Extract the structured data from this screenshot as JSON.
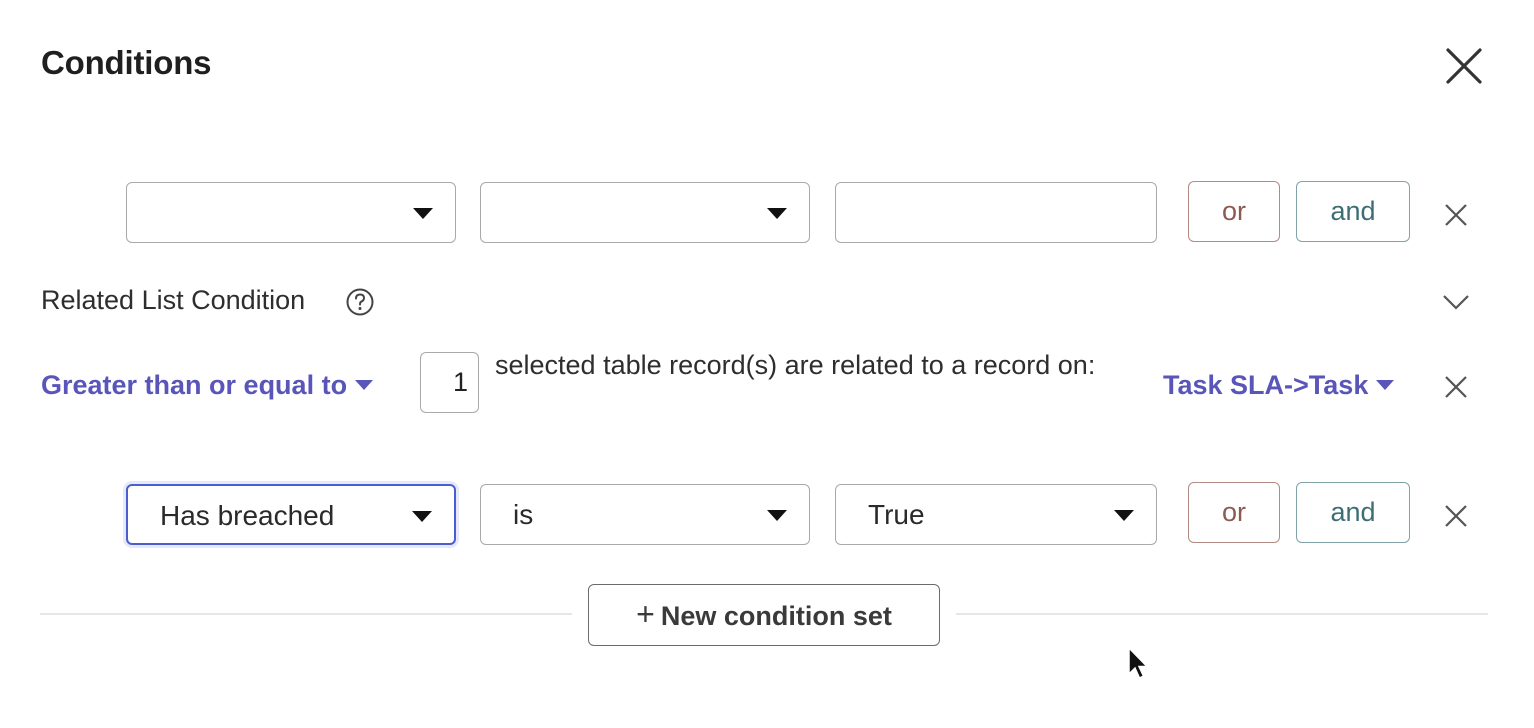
{
  "dialog": {
    "title": "Conditions"
  },
  "condition_row_1": {
    "field_value": "",
    "operator_value": "",
    "value_text": "",
    "or_label": "or",
    "and_label": "and"
  },
  "related_list": {
    "label": "Related List Condition",
    "quantifier": "Greater than or equal to",
    "count": "1",
    "description": "selected table record(s) are related to a record on:",
    "relationship": "Task SLA->Task"
  },
  "condition_row_2": {
    "field_value": "Has breached",
    "operator_value": "is",
    "value_value": "True",
    "or_label": "or",
    "and_label": "and"
  },
  "footer": {
    "new_condition_set_label": "New condition set",
    "plus_symbol": "+"
  },
  "icons": {
    "close": "close-icon",
    "help": "help-circle-icon",
    "chevron": "chevron-down-icon",
    "remove": "remove-x-icon",
    "caret": "caret-down-icon"
  },
  "colors": {
    "link_purple": "#5a55b8",
    "or_border": "#b48a84",
    "and_border": "#7fa3a6",
    "focus_blue": "#4a5ecf"
  }
}
